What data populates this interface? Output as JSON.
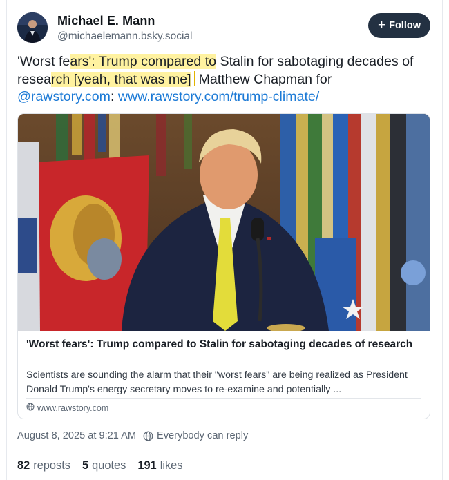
{
  "author": {
    "name": "Michael E. Mann",
    "handle": "@michaelemann.bsky.social"
  },
  "follow_button": {
    "icon": "plus-icon",
    "label": "Follow"
  },
  "post": {
    "text_part1": "'Worst fe",
    "highlight1": "ars': Trump compared to",
    "text_part2": " Stalin for sabotaging decades of resea",
    "highlight2": "rch [yeah, that was me]",
    "text_part3": "Matthew Chapman for",
    "mention": "@rawstory.com",
    "colon": ":",
    "url": "www.rawstory.com/trump-climate/"
  },
  "link_card": {
    "title": "'Worst fears': Trump compared to Stalin for sabotaging decades of research",
    "description": "Scientists are sounding the alarm that their \"worst fears\" are being realized as President Donald Trump's energy secretary moves to re-examine and potentially ...",
    "domain": "www.rawstory.com",
    "domain_icon": "globe-icon"
  },
  "meta": {
    "timestamp": "August 8, 2025 at 9:21 AM",
    "reply_setting_icon": "globe-icon",
    "reply_setting": "Everybody can reply"
  },
  "stats": {
    "reposts_count": "82",
    "reposts_label": "reposts",
    "quotes_count": "5",
    "quotes_label": "quotes",
    "likes_count": "191",
    "likes_label": "likes"
  },
  "colors": {
    "link": "#1c7ad6",
    "highlight": "#fff2a0",
    "follow_bg": "#233142"
  }
}
